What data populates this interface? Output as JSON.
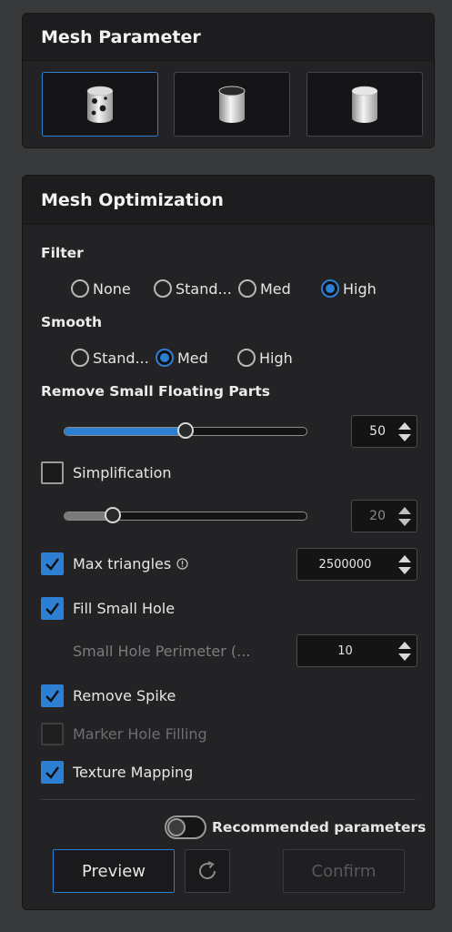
{
  "mesh_parameter": {
    "title": "Mesh Parameter",
    "modes": [
      {
        "icon": "cylinder-with-holes-icon",
        "active": true
      },
      {
        "icon": "cylinder-watertight-icon",
        "active": false
      },
      {
        "icon": "cylinder-smooth-icon",
        "active": false
      }
    ]
  },
  "mesh_optimization": {
    "title": "Mesh Optimization",
    "filter": {
      "label": "Filter",
      "options": [
        "None",
        "Stand...",
        "Med",
        "High"
      ],
      "selected": "High"
    },
    "smooth": {
      "label": "Smooth",
      "options": [
        "Stand...",
        "Med",
        "High"
      ],
      "selected": "Med"
    },
    "remove_floating": {
      "label": "Remove Small Floating Parts",
      "value": "50",
      "slider_fraction": 0.5
    },
    "simplification": {
      "label": "Simplification",
      "checked": false,
      "value": "20",
      "slider_fraction": 0.2
    },
    "max_triangles": {
      "label": "Max triangles",
      "checked": true,
      "info_icon": "info-circle-icon",
      "value": "2500000"
    },
    "fill_small_hole": {
      "label": "Fill Small Hole",
      "checked": true
    },
    "small_hole_perimeter": {
      "label": "Small Hole Perimeter (...",
      "value": "10"
    },
    "remove_spike": {
      "label": "Remove Spike",
      "checked": true
    },
    "marker_hole_filling": {
      "label": "Marker Hole Filling",
      "checked": false,
      "disabled": true
    },
    "texture_mapping": {
      "label": "Texture Mapping",
      "checked": true
    },
    "recommended": {
      "label": "Recommended parameters",
      "on": false
    },
    "buttons": {
      "preview": "Preview",
      "refresh_icon": "refresh-icon",
      "confirm": "Confirm"
    }
  },
  "colors": {
    "accent": "#2d7fd3",
    "panel": "#232325",
    "background": "#38393b"
  }
}
